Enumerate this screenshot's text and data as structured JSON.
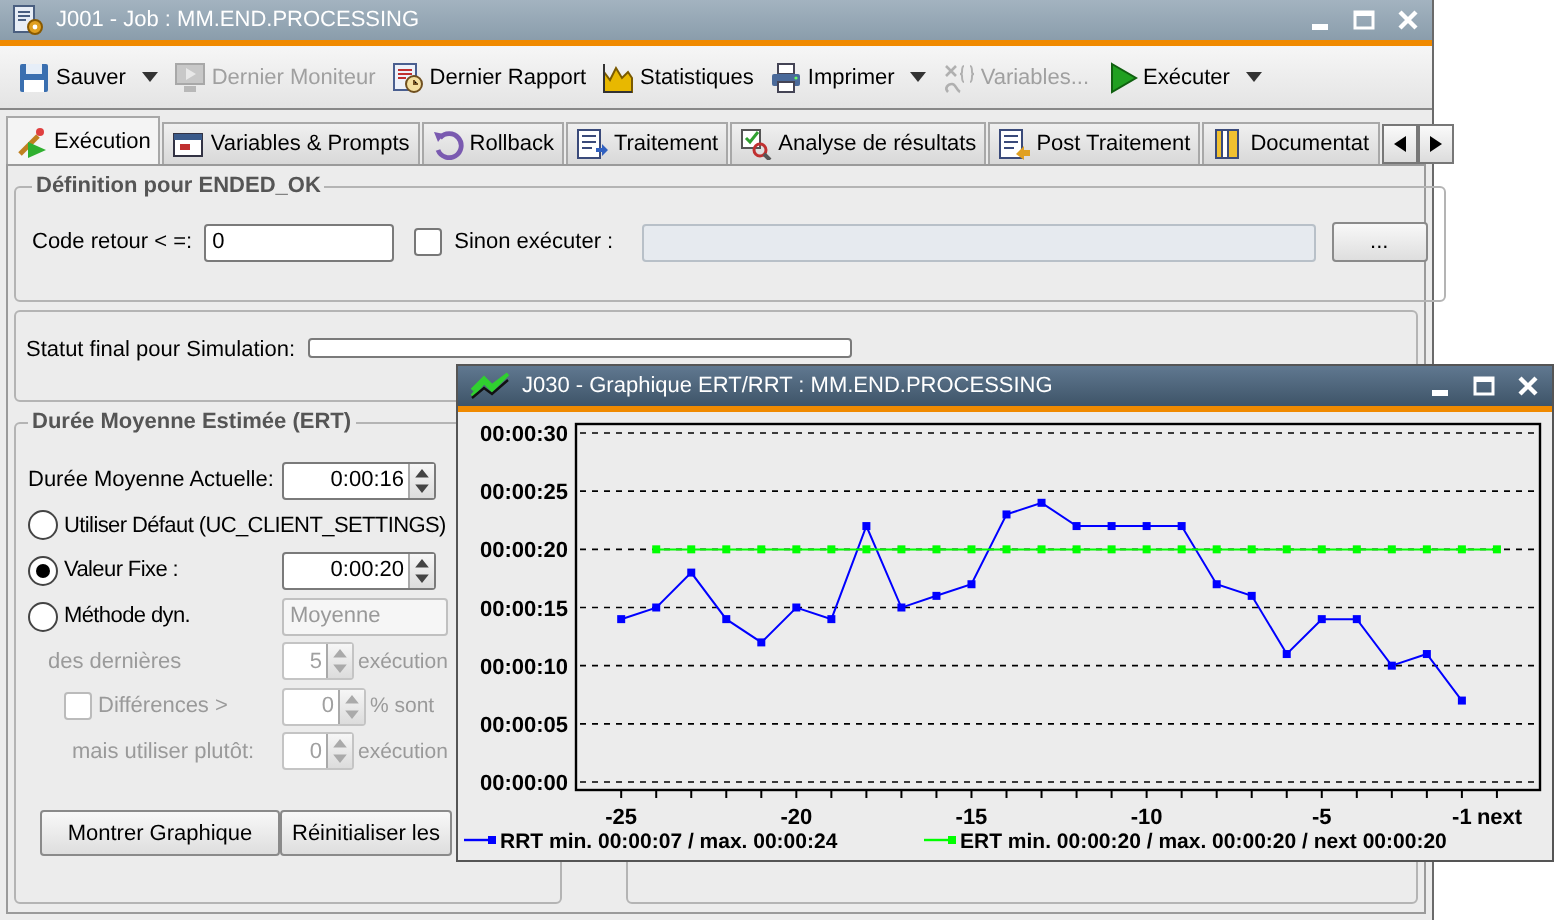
{
  "window": {
    "title": "J001 - Job : MM.END.PROCESSING"
  },
  "toolbar": [
    {
      "label": "Sauver",
      "dropdown": true,
      "disabled": false
    },
    {
      "label": "Dernier Moniteur",
      "dropdown": false,
      "disabled": true
    },
    {
      "label": "Dernier Rapport",
      "dropdown": false,
      "disabled": false
    },
    {
      "label": "Statistiques",
      "dropdown": false,
      "disabled": false
    },
    {
      "label": "Imprimer",
      "dropdown": true,
      "disabled": false
    },
    {
      "label": "Variables...",
      "dropdown": false,
      "disabled": true
    },
    {
      "label": "Exécuter",
      "dropdown": true,
      "disabled": false
    }
  ],
  "tabs": [
    {
      "label": "Exécution",
      "selected": true
    },
    {
      "label": "Variables & Prompts",
      "selected": false
    },
    {
      "label": "Rollback",
      "selected": false
    },
    {
      "label": "Traitement",
      "selected": false
    },
    {
      "label": "Analyse de résultats",
      "selected": false
    },
    {
      "label": "Post Traitement",
      "selected": false
    },
    {
      "label": "Documentat",
      "selected": false
    }
  ],
  "definition": {
    "title": "Définition pour ENDED_OK",
    "code_label": "Code retour < =:",
    "code_value": "0",
    "else_checkbox": {
      "label": "Sinon exécuter :",
      "checked": false
    },
    "browse_button": "..."
  },
  "simulation": {
    "label": "Statut final pour Simulation:"
  },
  "ert": {
    "title": "Durée Moyenne Estimée (ERT)",
    "current": {
      "label": "Durée Moyenne Actuelle:",
      "value": "0:00:16"
    },
    "options": [
      {
        "label": "Utiliser Défaut (UC_CLIENT_SETTINGS)",
        "selected": false
      },
      {
        "label": "Valeur Fixe :",
        "selected": true,
        "field": {
          "kind": "spin",
          "value": "0:00:20",
          "disabled": false
        }
      },
      {
        "label": "Méthode dyn.",
        "selected": false,
        "field": {
          "kind": "select",
          "value": "Moyenne",
          "disabled": true
        }
      }
    ],
    "rows": [
      {
        "kind": "text",
        "label": "des dernières",
        "value": "5",
        "suffix": "exécution",
        "disabled": true
      },
      {
        "kind": "check",
        "label": "Différences >",
        "checked": false,
        "value": "0",
        "suffix": "% sont",
        "disabled": true
      },
      {
        "kind": "text",
        "label": "mais utiliser plutôt:",
        "value": "0",
        "suffix": "exécution",
        "disabled": true
      }
    ],
    "buttons": [
      "Montrer Graphique",
      "Réinitialiser les"
    ]
  },
  "chart_window": {
    "title": "J030 - Graphique ERT/RRT : MM.END.PROCESSING",
    "chart_data": {
      "type": "line",
      "x": [
        -25,
        -24,
        -23,
        -22,
        -21,
        -20,
        -19,
        -18,
        -17,
        -16,
        -15,
        -14,
        -13,
        -12,
        -11,
        -10,
        -9,
        -8,
        -7,
        -6,
        -5,
        -4,
        -3,
        -2,
        -1,
        0
      ],
      "xticks": [
        {
          "value": -25,
          "label": "-25"
        },
        {
          "value": -20,
          "label": "-20"
        },
        {
          "value": -15,
          "label": "-15"
        },
        {
          "value": -10,
          "label": "-10"
        },
        {
          "value": -5,
          "label": "-5"
        },
        {
          "value": -1,
          "label": "-1"
        },
        {
          "value": 0,
          "label": "next"
        }
      ],
      "ylim": [
        0,
        30
      ],
      "yticks": [
        {
          "value": 0,
          "label": "00:00:00"
        },
        {
          "value": 5,
          "label": "00:00:05"
        },
        {
          "value": 10,
          "label": "00:00:10"
        },
        {
          "value": 15,
          "label": "00:00:15"
        },
        {
          "value": 20,
          "label": "00:00:20"
        },
        {
          "value": 25,
          "label": "00:00:25"
        },
        {
          "value": 30,
          "label": "00:00:30"
        }
      ],
      "grid": true,
      "xlim": [
        -26.29,
        1.23
      ],
      "legend": true,
      "series": [
        {
          "name": "RRT min. 00:00:07 / max. 00:00:24",
          "color": "#0000ff",
          "marker": "square",
          "values": [
            14,
            15,
            18,
            14,
            12,
            15,
            14,
            22,
            15,
            16,
            17,
            23,
            24,
            22,
            22,
            22,
            22,
            17,
            16,
            11,
            14,
            14,
            10,
            11,
            7,
            null
          ]
        },
        {
          "name": "ERT min. 00:00:20 / max. 00:00:20 / next 00:00:20",
          "color": "#00ff00",
          "marker": "square",
          "values": [
            null,
            20,
            20,
            20,
            20,
            20,
            20,
            20,
            20,
            20,
            20,
            20,
            20,
            20,
            20,
            20,
            20,
            20,
            20,
            20,
            20,
            20,
            20,
            20,
            20,
            20
          ]
        }
      ]
    }
  }
}
